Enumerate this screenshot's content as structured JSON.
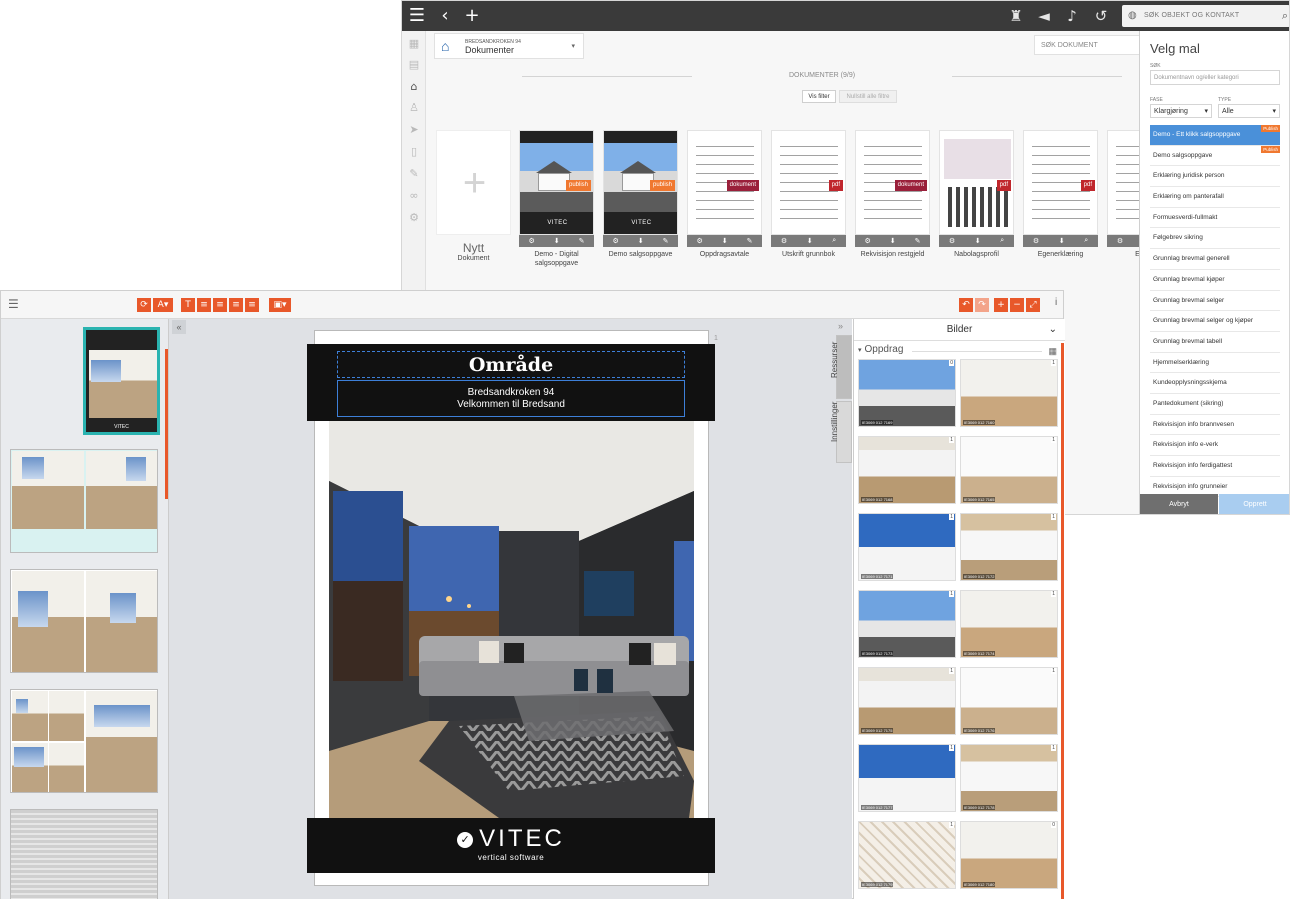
{
  "back_window": {
    "global_search_placeholder": "SØK OBJEKT OG KONTAKT",
    "breadcrumb": {
      "object": "BREDSANDKROKEN 94",
      "section": "Dokumenter"
    },
    "document_search_placeholder": "SØK DOKUMENT",
    "documents_count": "DOKUMENTER (9/9)",
    "filter_button": "Vis filter",
    "reset_button": "Nullstill alle filtre",
    "new_document": {
      "line1": "Nytt",
      "line2": "Dokument"
    },
    "documents": [
      {
        "label": "Demo - Digital salgsoppgave",
        "tag": "publish",
        "tag_color": "#f07830",
        "kind": "brochure"
      },
      {
        "label": "Demo salgsoppgave",
        "tag": "publish",
        "tag_color": "#f07830",
        "kind": "brochure"
      },
      {
        "label": "Oppdragsavtale",
        "tag": "dokument",
        "tag_color": "#9a1f3a",
        "kind": "text"
      },
      {
        "label": "Utskrift grunnbok",
        "tag": "pdf",
        "tag_color": "#c0262c",
        "kind": "text"
      },
      {
        "label": "Rekvisisjon restgjeld",
        "tag": "dokument",
        "tag_color": "#9a1f3a",
        "kind": "text"
      },
      {
        "label": "Nabolagsprofil",
        "tag": "pdf",
        "tag_color": "#c0262c",
        "kind": "map"
      },
      {
        "label": "Egenerklæring",
        "tag": "pdf",
        "tag_color": "#c0262c",
        "kind": "text"
      },
      {
        "label": "Energ",
        "tag": "",
        "tag_color": "",
        "kind": "text"
      }
    ]
  },
  "velg_mal": {
    "title": "Velg mal",
    "search_label": "SØK",
    "search_placeholder": "Dokumentnavn og/eller kategori",
    "type_label": "FASE",
    "type_value": "Klargjøring",
    "kind_label": "TYPE",
    "kind_value": "Alle",
    "templates": [
      {
        "label": "Demo - Ett klikk salgsoppgave",
        "badge": "Publish",
        "selected": true
      },
      {
        "label": "Demo salgsoppgave",
        "badge": "Publish",
        "selected": false
      },
      {
        "label": "Erklæring juridisk person",
        "badge": "",
        "selected": false
      },
      {
        "label": "Erklæring om panterafall",
        "badge": "",
        "selected": false
      },
      {
        "label": "Formuesverdi-fullmakt",
        "badge": "",
        "selected": false
      },
      {
        "label": "Følgebrev sikring",
        "badge": "",
        "selected": false
      },
      {
        "label": "Grunnlag brevmal generell",
        "badge": "",
        "selected": false
      },
      {
        "label": "Grunnlag brevmal kjøper",
        "badge": "",
        "selected": false
      },
      {
        "label": "Grunnlag brevmal selger",
        "badge": "",
        "selected": false
      },
      {
        "label": "Grunnlag brevmal selger og kjøper",
        "badge": "",
        "selected": false
      },
      {
        "label": "Grunnlag brevmal tabell",
        "badge": "",
        "selected": false
      },
      {
        "label": "Hjemmelserklæring",
        "badge": "",
        "selected": false
      },
      {
        "label": "Kundeopplysningsskjema",
        "badge": "",
        "selected": false
      },
      {
        "label": "Pantedokument (sikring)",
        "badge": "",
        "selected": false
      },
      {
        "label": "Rekvisisjon info brannvesen",
        "badge": "",
        "selected": false
      },
      {
        "label": "Rekvisisjon info e-verk",
        "badge": "",
        "selected": false
      },
      {
        "label": "Rekvisisjon info ferdigattest",
        "badge": "",
        "selected": false
      },
      {
        "label": "Rekvisisjon info grunneier",
        "badge": "",
        "selected": false
      }
    ],
    "cancel_button": "Avbryt",
    "create_button": "Opprett"
  },
  "editor": {
    "page_number": "1",
    "sheet_title": "Område",
    "sheet_subtitle_1": "Bredsandkroken 94",
    "sheet_subtitle_2": "Velkommen til Bredsand",
    "logo_text": "VITEC",
    "logo_tagline": "vertical software",
    "side_tabs": [
      "Ressurser",
      "Innstillinger"
    ],
    "resources_title": "Bilder",
    "resources_section": "Oppdrag",
    "images": [
      {
        "caption": "IE3069 012 7169",
        "count": "0"
      },
      {
        "caption": "IE3069 012 7160",
        "count": "1"
      },
      {
        "caption": "IE3069 012 7168",
        "count": "1"
      },
      {
        "caption": "IE3069 012 7165",
        "count": "1"
      },
      {
        "caption": "IE3069 012 7171",
        "count": "1"
      },
      {
        "caption": "IE3069 012 7172",
        "count": "1"
      },
      {
        "caption": "IE3069 012 7173",
        "count": "1"
      },
      {
        "caption": "IE3069 012 7174",
        "count": "1"
      },
      {
        "caption": "IE3069 012 7175",
        "count": "1"
      },
      {
        "caption": "IE3069 012 7176",
        "count": "1"
      },
      {
        "caption": "IE3069 012 7177",
        "count": "1"
      },
      {
        "caption": "IE3069 012 7178",
        "count": "1"
      },
      {
        "caption": "IE3069 012 7179",
        "count": "1"
      },
      {
        "caption": "IE3069 012 7180",
        "count": "0"
      }
    ]
  }
}
